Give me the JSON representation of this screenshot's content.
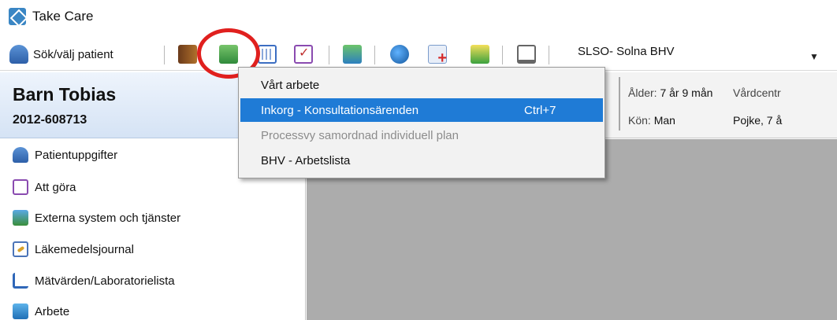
{
  "window": {
    "title": "Take Care",
    "app_icon": "take-care-logo-icon"
  },
  "toolbar": {
    "patient_button_label": "Sök/välj patient",
    "location": "SLSO- Solna BHV",
    "dropdown_glyph": "▼",
    "icons": [
      "person-search-icon",
      "book-icon",
      "group-icon",
      "calculator-icon",
      "checklist-icon",
      "person-screen-icon",
      "globe-icon",
      "add-referral-icon",
      "money-icon",
      "computer-icon"
    ]
  },
  "patient": {
    "name": "Barn Tobias",
    "id": "2012-608713",
    "age_label": "Ålder:",
    "age_value": "7 år 9 mån",
    "gender_label": "Kön:",
    "gender_value": "Man",
    "vardcentral_label": "Vårdcentr",
    "group_value": "Pojke, 7 å"
  },
  "menu": {
    "items": [
      {
        "label": "Vårt arbete",
        "shortcut": "",
        "state": "normal"
      },
      {
        "label": "Inkorg - Konsultationsärenden",
        "shortcut": "Ctrl+7",
        "state": "selected"
      },
      {
        "label": "Processvy samordnad individuell plan",
        "shortcut": "",
        "state": "disabled"
      },
      {
        "label": "BHV - Arbetslista",
        "shortcut": "",
        "state": "normal"
      }
    ]
  },
  "sidebar": {
    "items": [
      {
        "label": "Patientuppgifter",
        "icon": "patient-info-icon"
      },
      {
        "label": "Att göra",
        "icon": "todo-check-icon"
      },
      {
        "label": "Externa system och tjänster",
        "icon": "external-systems-icon"
      },
      {
        "label": "Läkemedelsjournal",
        "icon": "medication-icon"
      },
      {
        "label": "Mätvärden/Laboratorielista",
        "icon": "lab-chart-icon"
      },
      {
        "label": "Arbete",
        "icon": "work-icon"
      }
    ]
  },
  "colors": {
    "selection": "#1f7bd6",
    "annotation": "#e0201e",
    "header_gradient_top": "#eef4fc",
    "content_background": "#acacac"
  }
}
